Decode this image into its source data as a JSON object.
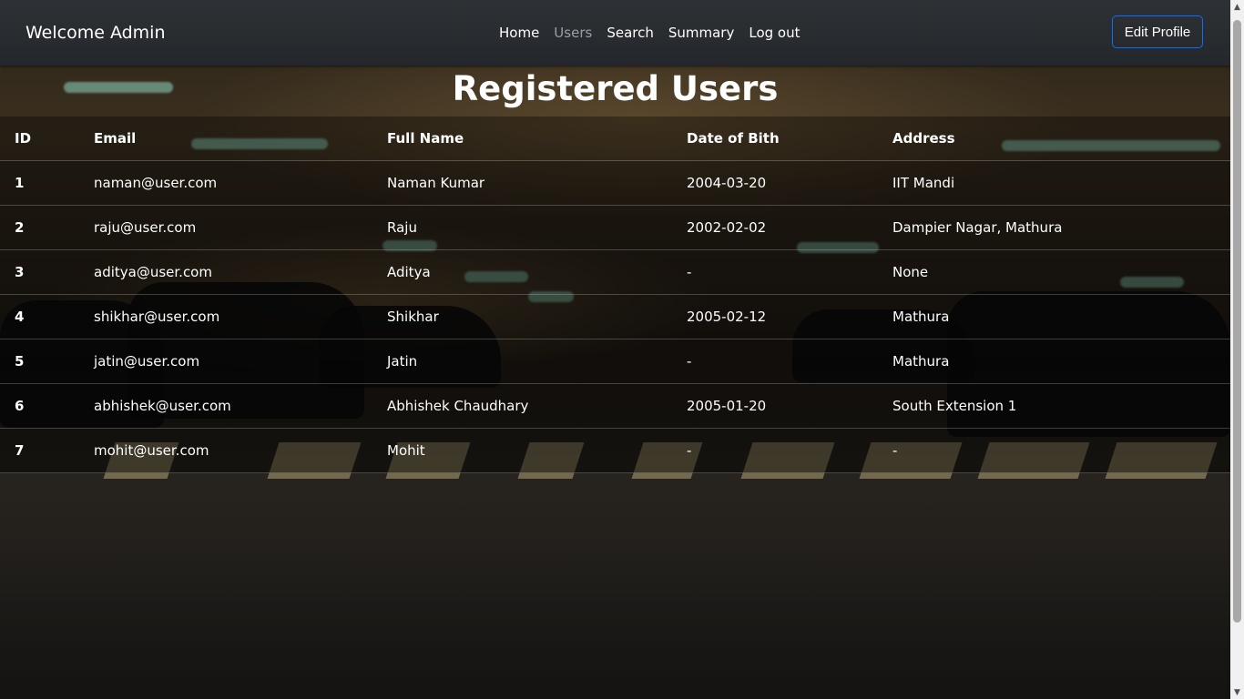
{
  "navbar": {
    "brand": "Welcome Admin",
    "links": [
      "Home",
      "Users",
      "Search",
      "Summary",
      "Log out"
    ],
    "active_link": "Users",
    "edit_profile_label": "Edit Profile"
  },
  "page": {
    "title": "Registered Users"
  },
  "table": {
    "headers": [
      "ID",
      "Email",
      "Full Name",
      "Date of Bith",
      "Address"
    ],
    "rows": [
      [
        "1",
        "naman@user.com",
        "Naman Kumar",
        "2004-03-20",
        "IIT Mandi"
      ],
      [
        "2",
        "raju@user.com",
        "Raju",
        "2002-02-02",
        "Dampier Nagar, Mathura"
      ],
      [
        "3",
        "aditya@user.com",
        "Aditya",
        "-",
        "None"
      ],
      [
        "4",
        "shikhar@user.com",
        "Shikhar",
        "2005-02-12",
        "Mathura"
      ],
      [
        "5",
        "jatin@user.com",
        "Jatin",
        "-",
        "Mathura"
      ],
      [
        "6",
        "abhishek@user.com",
        "Abhishek Chaudhary",
        "2005-01-20",
        "South Extension 1"
      ],
      [
        "7",
        "mohit@user.com",
        "Mohit",
        "-",
        "-"
      ]
    ]
  },
  "colors": {
    "navbar": "#2b2e32",
    "accent_border": "#0d6efd",
    "muted_link": "#9aa0a6"
  },
  "icons": {
    "scroll_up": "triangle-up-icon",
    "scroll_down": "triangle-down-icon"
  }
}
